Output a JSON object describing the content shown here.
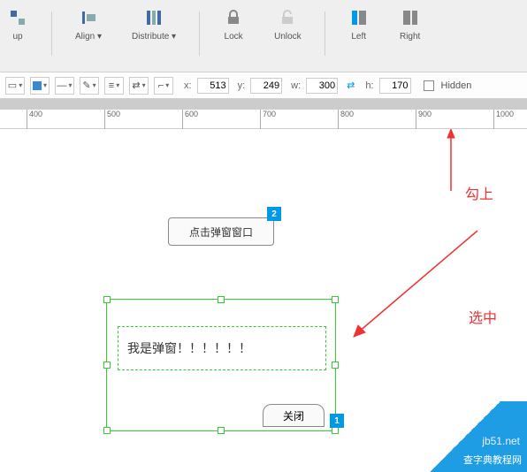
{
  "toolbar": {
    "group_label": "up",
    "align_label": "Align ▾",
    "distribute_label": "Distribute ▾",
    "lock_label": "Lock",
    "unlock_label": "Unlock",
    "left_label": "Left",
    "right_label": "Right"
  },
  "props": {
    "x_label": "x:",
    "x_value": "513",
    "y_label": "y:",
    "y_value": "249",
    "w_label": "w:",
    "w_value": "300",
    "h_label": "h:",
    "h_value": "170",
    "hidden_label": "Hidden"
  },
  "ruler": {
    "ticks": [
      "400",
      "500",
      "600",
      "700",
      "800",
      "900",
      "1000"
    ]
  },
  "widgets": {
    "button_text": "点击弹窗窗口",
    "badge2": "2",
    "popup_text": "我是弹窗！！！！！！",
    "close_text": "关闭",
    "badge1": "1"
  },
  "annotations": {
    "check_label": "勾上",
    "select_label": "选中"
  },
  "watermark": {
    "site": "jb51.net",
    "text": "查字典教程网"
  }
}
